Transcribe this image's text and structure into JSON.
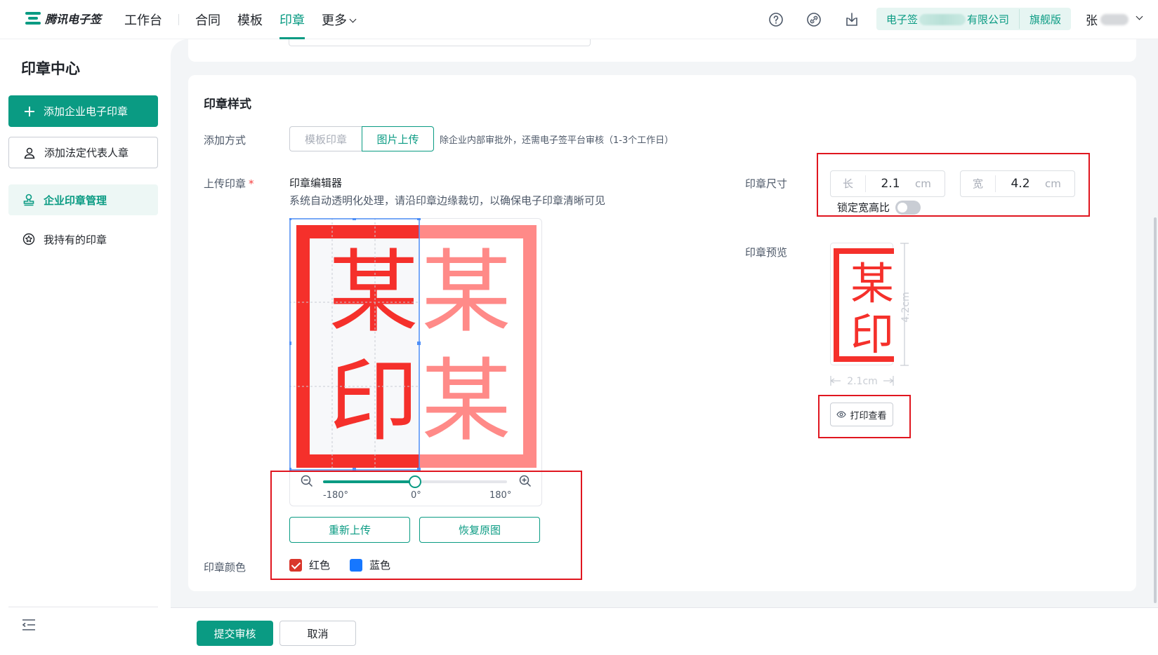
{
  "topbar": {
    "logo_text": "腾讯电子签",
    "workbench": "工作台",
    "nav": [
      {
        "label": "合同"
      },
      {
        "label": "模板"
      },
      {
        "label": "印章"
      },
      {
        "label": "更多"
      }
    ],
    "org": {
      "prefix": "电子签",
      "suffix": "有限公司",
      "edition": "旗舰版"
    },
    "user_name": "张"
  },
  "sidebar": {
    "title": "印章中心",
    "add_enterprise_seal": "添加企业电子印章",
    "add_legal_seal": "添加法定代表人章",
    "items": [
      {
        "label": "企业印章管理",
        "active": true
      },
      {
        "label": "我持有的印章",
        "active": false
      }
    ]
  },
  "form": {
    "section_title": "印章样式",
    "add_method_label": "添加方式",
    "add_method_options": [
      "模板印章",
      "图片上传"
    ],
    "add_method_selected": "图片上传",
    "add_method_hint": "除企业内部审批外，还需电子签平台审核（1-3个工作日）",
    "upload_label": "上传印章",
    "required_mark": "*",
    "editor_title": "印章编辑器",
    "editor_desc": "系统自动透明化处理，请沿印章边缘裁切，以确保电子印章清晰可见",
    "seal_chars": [
      "某",
      "某",
      "印",
      "某"
    ],
    "rotation": {
      "min_label": "-180°",
      "zero_label": "0°",
      "max_label": "180°",
      "value_deg": 0
    },
    "reupload": "重新上传",
    "restore": "恢复原图",
    "color_label": "印章颜色",
    "colors": [
      {
        "label": "红色",
        "checked": true,
        "hex": "#d9362b"
      },
      {
        "label": "蓝色",
        "checked": false,
        "hex": "#1677ff"
      }
    ],
    "size_label": "印章尺寸",
    "length": {
      "prefix": "长",
      "value": "2.1",
      "unit": "cm"
    },
    "width": {
      "prefix": "宽",
      "value": "4.2",
      "unit": "cm"
    },
    "lock_ratio": "锁定宽高比",
    "lock_ratio_on": false,
    "preview_label": "印章预览",
    "preview_chars": [
      "某",
      "印"
    ],
    "preview_height_label": "4.2cm",
    "preview_width_label": "2.1cm",
    "print_view": "打印查看"
  },
  "footer": {
    "submit": "提交审核",
    "cancel": "取消"
  },
  "colors": {
    "accent": "#0a9b83",
    "seal_red": "#f5302b",
    "annotation_red": "#e0161f"
  }
}
